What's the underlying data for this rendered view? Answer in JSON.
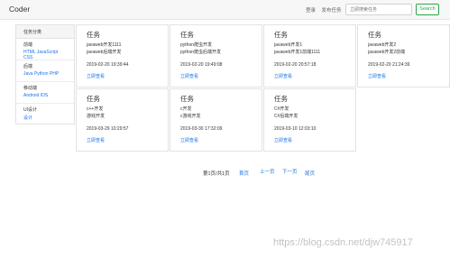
{
  "navbar": {
    "brand": "Coder",
    "links": [
      "登录",
      "发布任务"
    ],
    "search_placeholder": "立即搜索任务",
    "search_button": "Search"
  },
  "sidebar": {
    "header": "任务分类",
    "groups": [
      {
        "title": "前端",
        "links": "HTML JavaScript CSS"
      },
      {
        "title": "后端",
        "links": "Java Python PHP"
      },
      {
        "title": "移动端",
        "links": "Android IOS"
      },
      {
        "title": "UI设计",
        "links": "设计"
      }
    ]
  },
  "cards": [
    {
      "title": "任务",
      "line1": "javaweb开发1111",
      "line2": "javaweb后端开发",
      "time": "2019-02-20 19:39:44",
      "link": "立即查看"
    },
    {
      "title": "任务",
      "line1": "python爬虫开发",
      "line2": "python爬虫后端开发",
      "time": "2019-02-20 19:49:08",
      "link": "立即查看"
    },
    {
      "title": "任务",
      "line1": "javaweb开发1",
      "line2": "javaweb开发1前端1111",
      "time": "2019-02-20 20:57:18",
      "link": "立即查看"
    },
    {
      "title": "任务",
      "line1": "javaweb开发2",
      "line2": "javaweb开发2前端",
      "time": "2019-02-20 21:24:39",
      "link": "立即查看"
    },
    {
      "title": "任务",
      "line1": "c++开发",
      "line2": "游戏开发",
      "time": "2019-03-29 10:29:57",
      "link": "立即查看"
    },
    {
      "title": "任务",
      "line1": "c开发",
      "line2": "c游戏开发",
      "time": "2019-03-30 17:32:09",
      "link": "立即查看"
    },
    {
      "title": "任务",
      "line1": "C#开发",
      "line2": "C#后端开发",
      "time": "2019-03-10 12:03:10",
      "link": "立即查看"
    }
  ],
  "pager": {
    "info": "第1页/共1页",
    "first": "首页",
    "prev": "上一页",
    "next": "下一页",
    "last": "尾页"
  },
  "watermark": "https://blog.csdn.net/djw745917"
}
